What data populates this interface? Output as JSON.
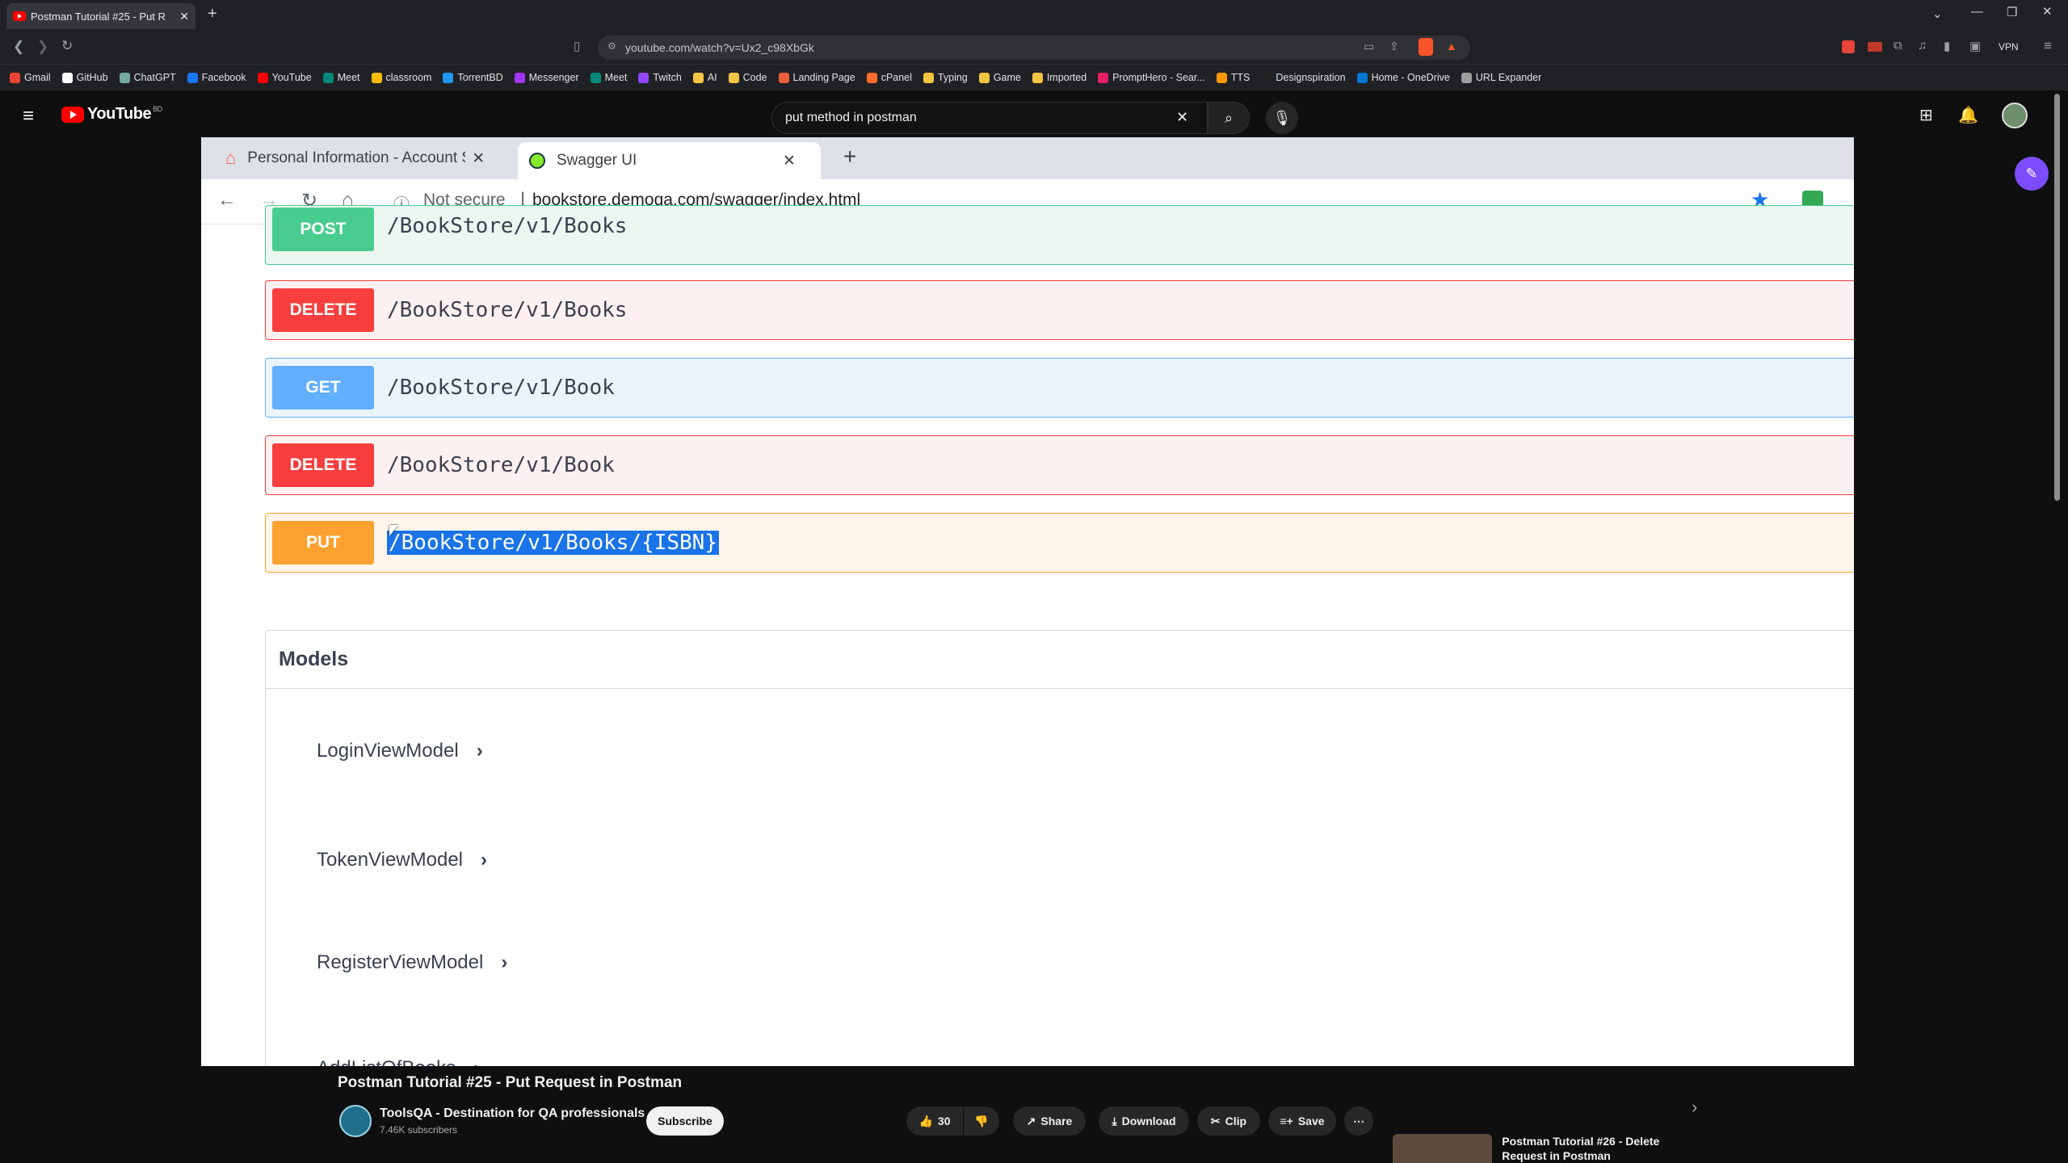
{
  "browser": {
    "tab_title": "Postman Tutorial #25 - Put R",
    "url": "youtube.com/watch?v=Ux2_c98XbGk",
    "vpn_label": "VPN",
    "bookmarks": [
      {
        "label": "Gmail",
        "color": "#ea4335"
      },
      {
        "label": "GitHub",
        "color": "#ffffff"
      },
      {
        "label": "ChatGPT",
        "color": "#74aa9c"
      },
      {
        "label": "Facebook",
        "color": "#1877f2"
      },
      {
        "label": "YouTube",
        "color": "#ff0000"
      },
      {
        "label": "Meet",
        "color": "#00897b"
      },
      {
        "label": "classroom",
        "color": "#fbbc04"
      },
      {
        "label": "TorrentBD",
        "color": "#2196f3"
      },
      {
        "label": "Messenger",
        "color": "#a334fa"
      },
      {
        "label": "Meet",
        "color": "#00897b"
      },
      {
        "label": "Twitch",
        "color": "#9146ff"
      },
      {
        "label": "AI",
        "color": "#f4c542"
      },
      {
        "label": "Code",
        "color": "#f4c542"
      },
      {
        "label": "Landing Page",
        "color": "#e8603c"
      },
      {
        "label": "cPanel",
        "color": "#ff6c2c"
      },
      {
        "label": "Typing",
        "color": "#f4c542"
      },
      {
        "label": "Game",
        "color": "#f4c542"
      },
      {
        "label": "Imported",
        "color": "#f4c542"
      },
      {
        "label": "PromptHero - Sear...",
        "color": "#e91e63"
      },
      {
        "label": "TTS",
        "color": "#ff9800"
      },
      {
        "label": "Designspiration",
        "color": "#222222"
      },
      {
        "label": "Home - OneDrive",
        "color": "#0078d4"
      },
      {
        "label": "URL Expander",
        "color": "#9e9e9e"
      }
    ]
  },
  "youtube": {
    "logo_text": "YouTube",
    "region": "BD",
    "search_query": "put method in postman",
    "video_title": "Postman Tutorial #25 - Put Request in Postman",
    "channel_name": "ToolsQA - Destination for QA professionals",
    "subscribers": "7.46K subscribers",
    "subscribe_label": "Subscribe",
    "likes": "30",
    "share_label": "Share",
    "download_label": "Download",
    "clip_label": "Clip",
    "save_label": "Save",
    "next_video_title": "Postman Tutorial #26 - Delete Request in Postman"
  },
  "video": {
    "tabs": [
      {
        "label": "Personal Information - Account S"
      },
      {
        "label": "Swagger UI"
      }
    ],
    "not_secure": "Not secure",
    "url": "bookstore.demoqa.com/swagger/index.html",
    "operations": [
      {
        "method": "POST",
        "path": "/BookStore/v1/Books"
      },
      {
        "method": "DELETE",
        "path": "/BookStore/v1/Books"
      },
      {
        "method": "GET",
        "path": "/BookStore/v1/Book"
      },
      {
        "method": "DELETE",
        "path": "/BookStore/v1/Book"
      },
      {
        "method": "PUT",
        "path_selected": "/BookStore/v1/Books/{ISBN}"
      }
    ],
    "models_title": "Models",
    "models": [
      "LoginViewModel",
      "TokenViewModel",
      "RegisterViewModel",
      "AddListOfBooks"
    ]
  }
}
